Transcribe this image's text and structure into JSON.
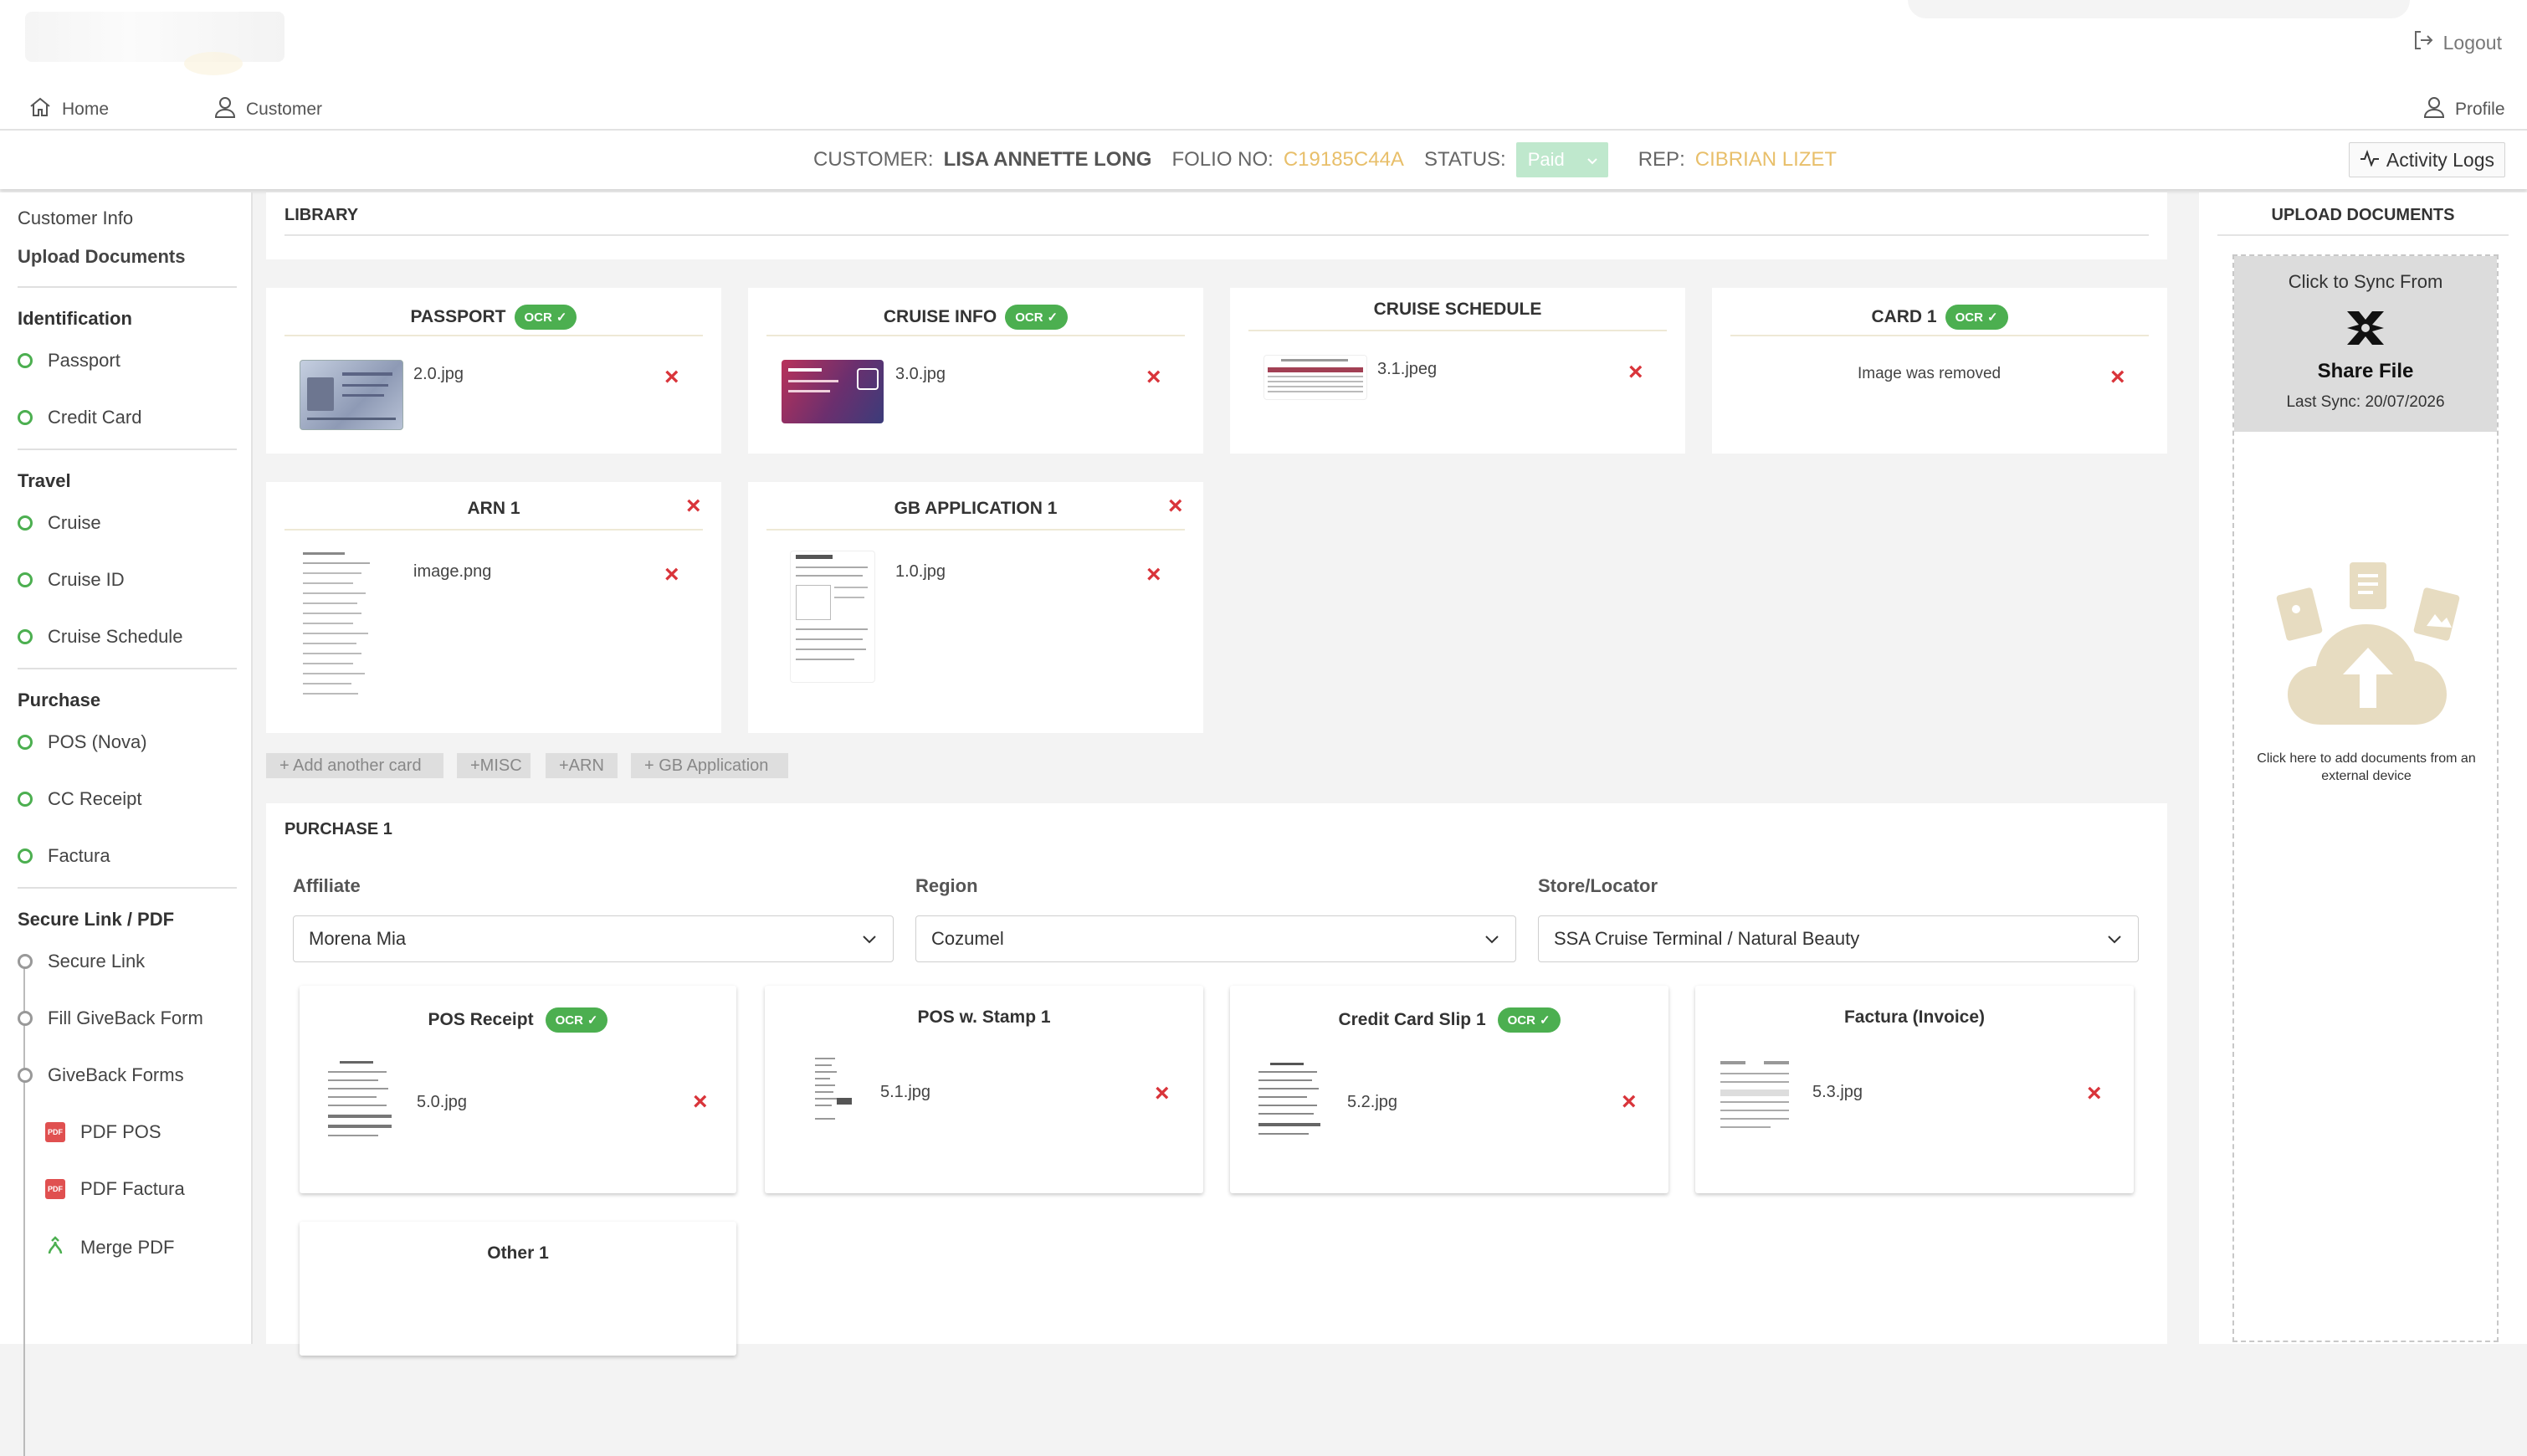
{
  "header": {
    "logout_label": "Logout"
  },
  "nav": {
    "home_label": "Home",
    "customer_label": "Customer",
    "profile_label": "Profile"
  },
  "customer_bar": {
    "customer_label": "CUSTOMER:",
    "customer_name": "LISA ANNETTE LONG",
    "folio_label": "FOLIO NO:",
    "folio_value": "C19185C44A",
    "status_label": "STATUS:",
    "status_value": "Paid",
    "rep_label": "REP:",
    "rep_value": "CIBRIAN LIZET",
    "activity_logs_label": "Activity Logs"
  },
  "sidebar": {
    "customer_info": "Customer Info",
    "upload_documents": "Upload Documents",
    "identification": {
      "heading": "Identification",
      "items": [
        "Passport",
        "Credit Card"
      ]
    },
    "travel": {
      "heading": "Travel",
      "items": [
        "Cruise",
        "Cruise ID",
        "Cruise Schedule"
      ]
    },
    "purchase": {
      "heading": "Purchase",
      "items": [
        "POS (Nova)",
        "CC Receipt",
        "Factura"
      ]
    },
    "secure": {
      "heading": "Secure Link / PDF",
      "items": [
        "Secure Link",
        "Fill GiveBack Form",
        "GiveBack Forms"
      ],
      "sub_items": [
        "PDF POS",
        "PDF Factura",
        "Merge PDF"
      ],
      "pdf_badge": "PDF"
    }
  },
  "library": {
    "title": "LIBRARY",
    "ocr_label": "OCR",
    "cards": [
      {
        "title": "PASSPORT",
        "file": "2.0.jpg"
      },
      {
        "title": "CRUISE INFO",
        "file": "3.0.jpg"
      },
      {
        "title": "CRUISE SCHEDULE",
        "file": "3.1.jpeg"
      },
      {
        "title": "CARD 1",
        "file": "Image was removed"
      },
      {
        "title": "ARN 1",
        "file": "image.png"
      },
      {
        "title": "GB APPLICATION 1",
        "file": "1.0.jpg"
      }
    ],
    "add_buttons": [
      "+ Add another card",
      "+MISC",
      "+ARN",
      "+ GB Application"
    ]
  },
  "purchase": {
    "title": "PURCHASE 1",
    "affiliate": {
      "label": "Affiliate",
      "value": "Morena Mia"
    },
    "region": {
      "label": "Region",
      "value": "Cozumel"
    },
    "store": {
      "label": "Store/Locator",
      "value": "SSA Cruise Terminal / Natural Beauty"
    },
    "cards": [
      {
        "title": "POS Receipt",
        "file": "5.0.jpg"
      },
      {
        "title": "POS w. Stamp 1",
        "file": "5.1.jpg"
      },
      {
        "title": "Credit Card Slip 1",
        "file": "5.2.jpg"
      },
      {
        "title": "Factura (Invoice)",
        "file": "5.3.jpg"
      },
      {
        "title": "Other 1"
      }
    ]
  },
  "upload": {
    "title": "UPLOAD DOCUMENTS",
    "sync_label": "Click to Sync From",
    "share_file": "Share File",
    "last_sync": "Last Sync: 20/07/2026",
    "add_hint": "Click here to add documents from an external device"
  },
  "colors": {
    "accent_green": "#4caf50",
    "gold": "#e8bf6a",
    "delete_red": "#d9343a"
  }
}
